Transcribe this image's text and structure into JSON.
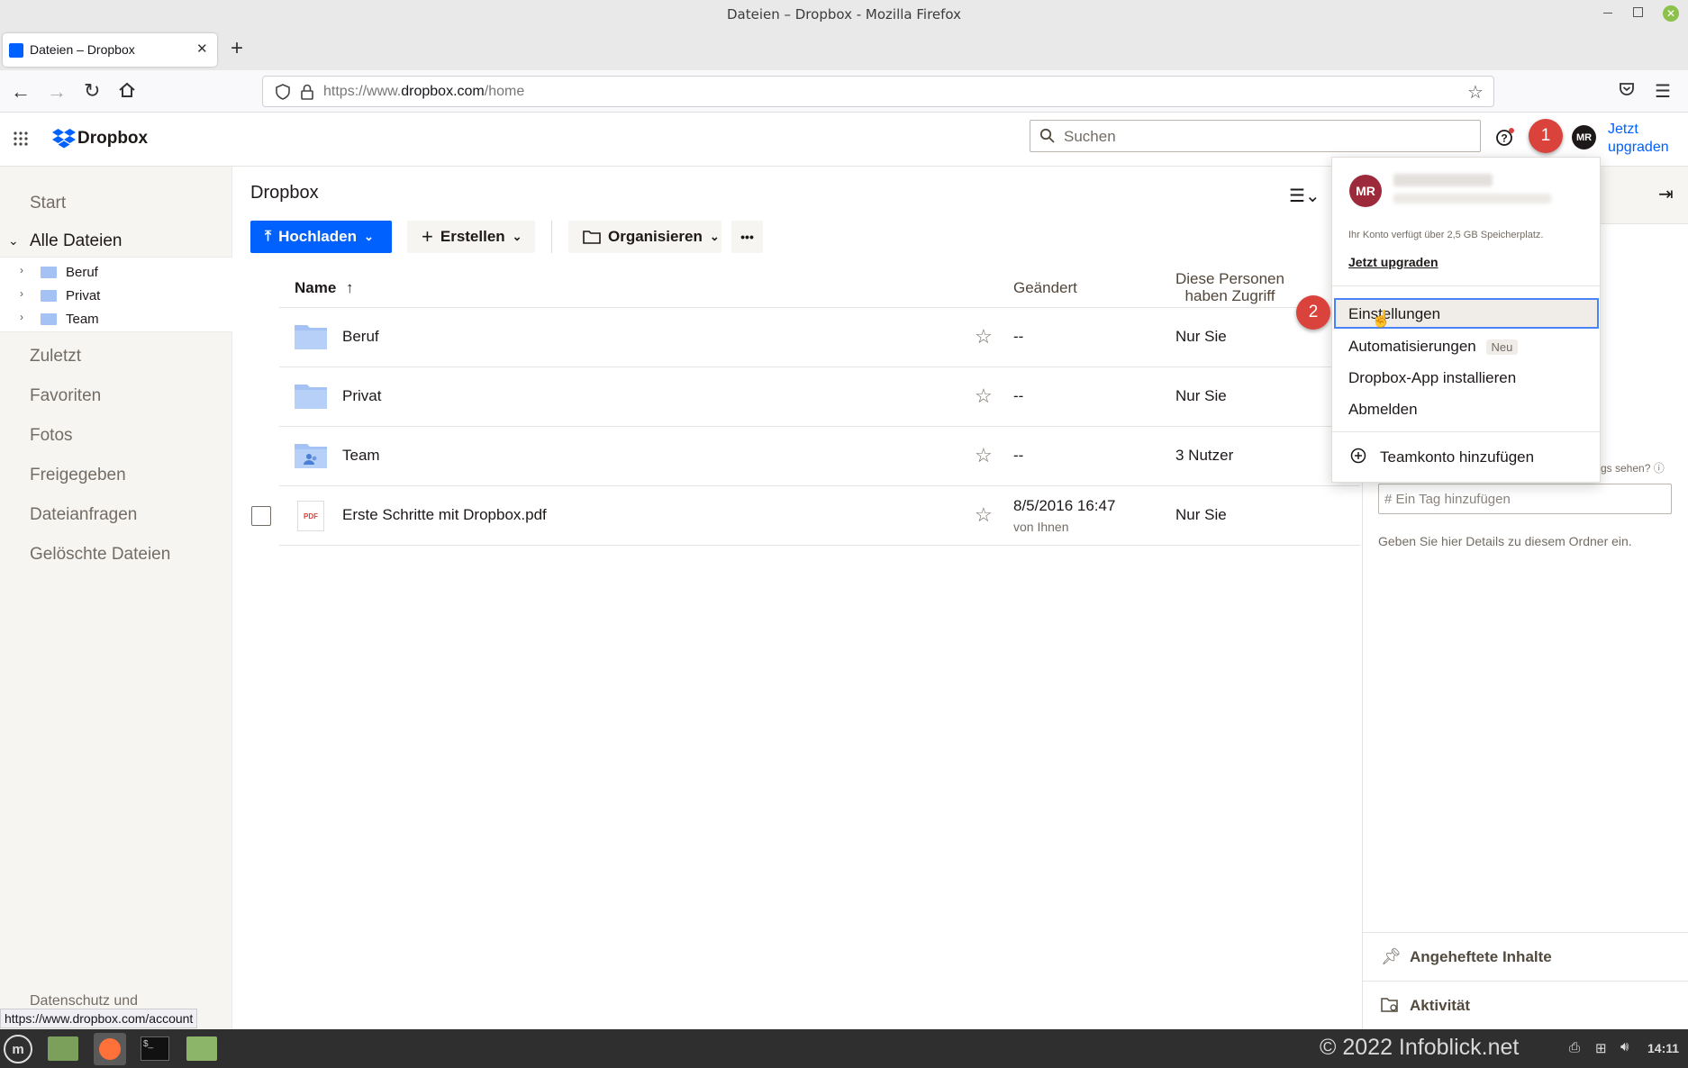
{
  "window": {
    "title": "Dateien – Dropbox - Mozilla Firefox"
  },
  "browser": {
    "tab_title": "Dateien – Dropbox",
    "url_prefix": "https://www.",
    "url_host": "dropbox.com",
    "url_path": "/home",
    "status_url": "https://www.dropbox.com/account"
  },
  "app": {
    "logo_text": "Dropbox",
    "search_placeholder": "Suchen",
    "avatar_initials": "MR",
    "upgrade_line1": "Jetzt",
    "upgrade_line2": "upgraden",
    "accent": "#0061fe"
  },
  "sidebar": {
    "start": "Start",
    "all_files": "Alle Dateien",
    "tree": [
      {
        "label": "Beruf"
      },
      {
        "label": "Privat"
      },
      {
        "label": "Team"
      }
    ],
    "nav": [
      "Zuletzt",
      "Favoriten",
      "Fotos",
      "Freigegeben",
      "Dateianfragen",
      "Gelöschte Dateien"
    ],
    "footer": "Datenschutz und"
  },
  "main": {
    "title": "Dropbox",
    "upload_label": "Hochladen",
    "create_label": "Erstellen",
    "organize_label": "Organisieren",
    "more_label": "•••",
    "col_name": "Name",
    "col_modified": "Geändert",
    "col_access_1": "Diese Personen",
    "col_access_2": "haben Zugriff",
    "rows": [
      {
        "name": "Beruf",
        "modified": "--",
        "access": "Nur Sie"
      },
      {
        "name": "Privat",
        "modified": "--",
        "access": "Nur Sie"
      },
      {
        "name": "Team",
        "modified": "--",
        "access": "3 Nutzer"
      },
      {
        "name": "Erste Schritte mit Dropbox.pdf",
        "modified": "8/5/2016 16:47",
        "modified_by": "von Ihnen",
        "access": "Nur Sie",
        "file_badge": "PDF"
      }
    ]
  },
  "menu": {
    "avatar_initials": "MR",
    "storage_note": "Ihr Konto verfügt über 2,5 GB Speicherplatz.",
    "upgrade": "Jetzt upgraden",
    "items": [
      "Einstellungen",
      "Automatisierungen",
      "Dropbox-App installieren",
      "Abmelden"
    ],
    "new_badge": "Neu",
    "add_team": "Teamkonto hinzufügen"
  },
  "right_panel": {
    "partial_text": "gs sehen?",
    "tag_placeholder": "# Ein Tag hinzufügen",
    "details_hint": "Geben Sie hier Details zu diesem Ordner ein.",
    "pinned": "Angeheftete Inhalte",
    "activity": "Aktivität"
  },
  "annotations": {
    "step1": "1",
    "step2": "2",
    "color": "#d9433b"
  },
  "taskbar": {
    "watermark": "© 2022 Infoblick.net",
    "clock": "14:11"
  }
}
